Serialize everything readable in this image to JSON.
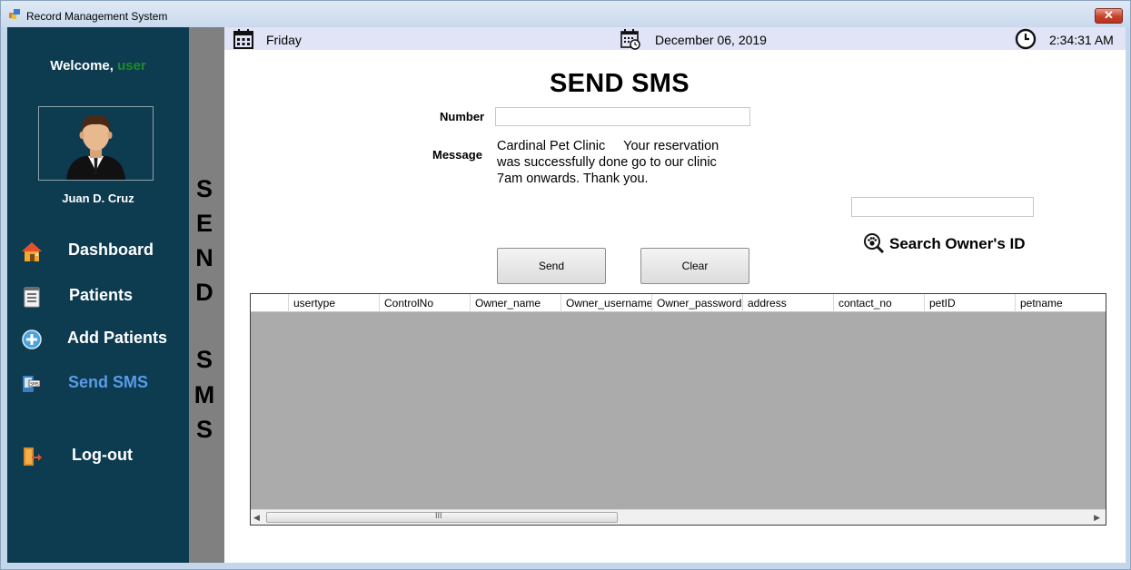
{
  "window": {
    "title": "Record Management System",
    "close_glyph": "✕"
  },
  "sidebar": {
    "welcome_prefix": "Welcome,",
    "welcome_user": "user",
    "full_name": "Juan D. Cruz",
    "items": [
      {
        "label": "Dashboard",
        "icon": "house-icon"
      },
      {
        "label": "Patients",
        "icon": "notepad-icon"
      },
      {
        "label": "Add Patients",
        "icon": "plus-circle-icon"
      },
      {
        "label": "Send SMS",
        "icon": "sms-phone-icon",
        "active": true
      },
      {
        "label": "Log-out",
        "icon": "exit-door-icon"
      }
    ],
    "active_color": "#5b9be8"
  },
  "vertical_banner": {
    "letters": [
      "S",
      "E",
      "N",
      "D",
      "S",
      "M",
      "S"
    ]
  },
  "topbar": {
    "day": "Friday",
    "date": "December 06,  2019",
    "time": "2:34:31 AM"
  },
  "form": {
    "title": "SEND SMS",
    "number_label": "Number",
    "number_value": "",
    "message_label": "Message",
    "message_value": "Cardinal Pet Clinic     Your reservation\nwas successfully done go to our clinic\n7am onwards. Thank you.",
    "search_value": "",
    "search_label": "Search Owner's ID",
    "send_label": "Send",
    "clear_label": "Clear"
  },
  "grid": {
    "columns": [
      "",
      "usertype",
      "ControlNo",
      "Owner_name",
      "Owner_username",
      "Owner_password",
      "address",
      "contact_no",
      "petID",
      "petname"
    ],
    "rows": [],
    "scroll_grip": "III"
  },
  "colors": {
    "sidebar_bg": "#0d3b50",
    "banner_bg": "#808080",
    "topbar_bg": "#e1e4f6",
    "welcome_user": "#1e8a2d"
  }
}
